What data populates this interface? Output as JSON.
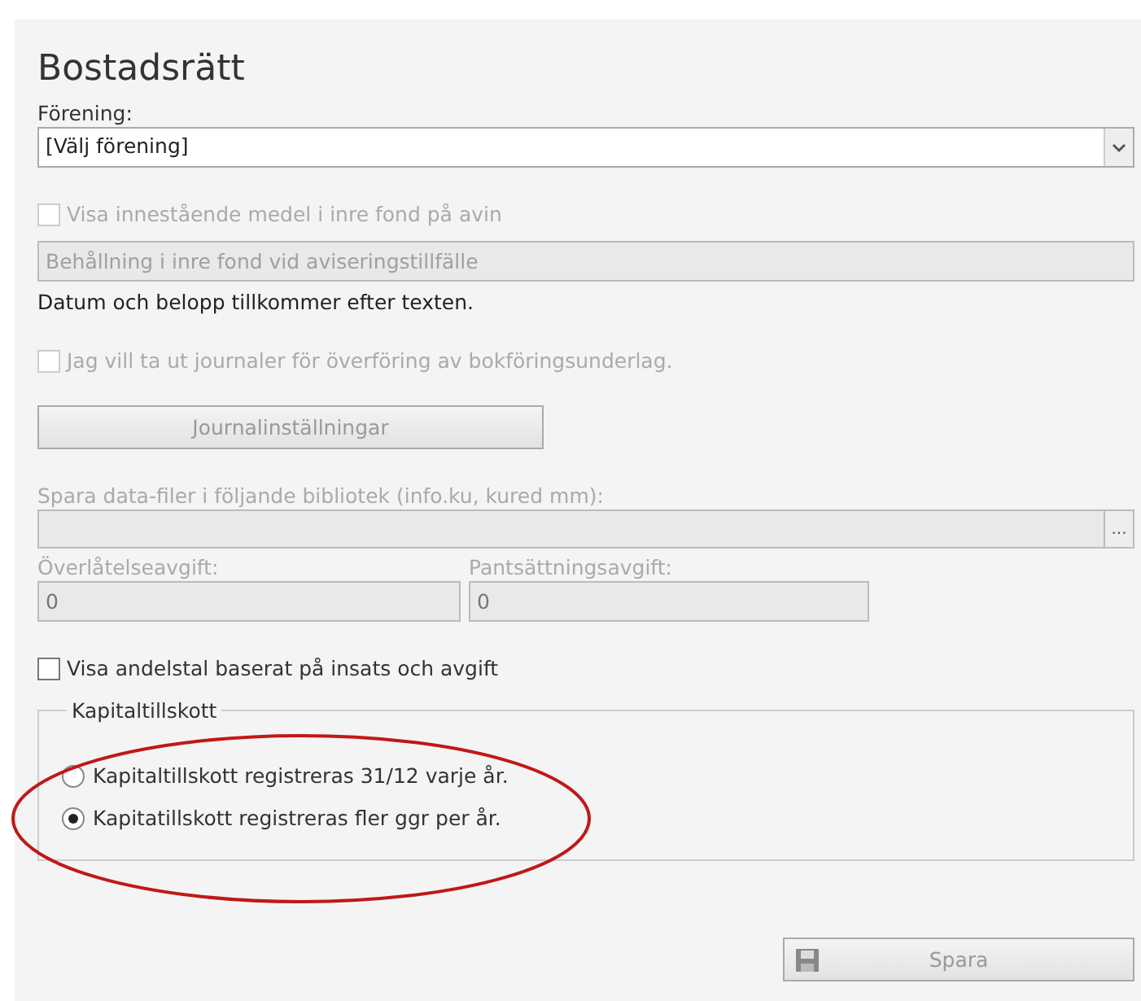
{
  "title": "Bostadsrätt",
  "association": {
    "label": "Förening:",
    "value": "[Välj förening]"
  },
  "inner_fund": {
    "checkbox": {
      "label": "Visa innestående medel i inre fond på avin",
      "checked": false,
      "disabled": true
    },
    "field": {
      "placeholder": "Behållning i inre fond vid aviseringstillfälle",
      "disabled": true
    },
    "note": "Datum och belopp tillkommer efter texten."
  },
  "journal": {
    "checkbox": {
      "label": "Jag vill ta ut journaler för överföring av bokföringsunderlag.",
      "checked": false,
      "disabled": true
    },
    "button": {
      "label": "Journalinställningar",
      "disabled": true
    }
  },
  "library": {
    "label": "Spara data-filer i följande bibliotek (info.ku, kured mm):",
    "browse": "...",
    "disabled": true
  },
  "fees": [
    {
      "label": "Överlåtelseavgift:",
      "value": "0",
      "disabled": true
    },
    {
      "label": "Pantsättningsavgift:",
      "value": "0",
      "disabled": true
    }
  ],
  "share_checkbox": {
    "label": "Visa andelstal baserat på insats och avgift",
    "checked": false,
    "disabled": false
  },
  "capital": {
    "legend": "Kapitaltillskott",
    "options": [
      {
        "label": "Kapitaltillskott registreras 31/12 varje år.",
        "selected": false
      },
      {
        "label": "Kapitatillskott registreras fler ggr per år.",
        "selected": true
      }
    ]
  },
  "save_button": {
    "label": "Spara",
    "disabled": true
  }
}
